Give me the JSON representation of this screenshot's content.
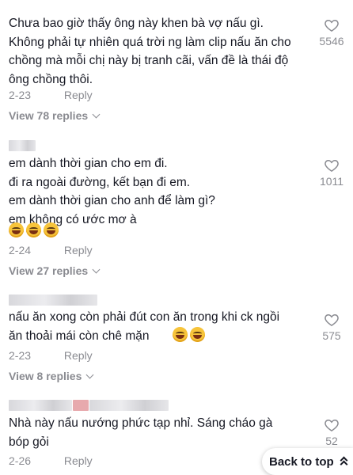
{
  "comments": [
    {
      "lines": [
        "Chưa bao giờ thấy ông này khen bà vợ nấu gì.",
        "Không phải tự nhiên quá trời ng làm clip nấu ăn cho",
        "chồng mà mỗi chị này bị tranh cãi, vấn đề là thái độ",
        "ông chồng thôi."
      ],
      "date": "2-23",
      "reply": "Reply",
      "likes": "5546",
      "view_replies": "View 78 replies"
    },
    {
      "lines": [
        "em dành thời gian cho em đi.",
        "đi ra ngoài đường, kết bạn đi em.",
        "em dành thời gian cho anh để làm gì?",
        "em không có ước mơ à"
      ],
      "emoji": [
        "laughing-emoji",
        "laughing-emoji",
        "laughing-emoji"
      ],
      "date": "2-24",
      "reply": "Reply",
      "likes": "1011",
      "view_replies": "View 27 replies"
    },
    {
      "lines": [
        "nấu ăn xong còn phải đút con ăn trong khi ck ngồi",
        "ăn thoải mái còn chê mặn"
      ],
      "emoji": [
        "grinning-sweat-emoji",
        "laughing-emoji"
      ],
      "date": "2-23",
      "reply": "Reply",
      "likes": "575",
      "view_replies": "View 8 replies"
    },
    {
      "lines": [
        "Nhà này nấu nướng phức tạp nhỉ. Sáng cháo gà",
        "bóp gỏi"
      ],
      "date": "2-26",
      "reply": "Reply",
      "likes": "52"
    }
  ],
  "back_to_top": "Back to top"
}
